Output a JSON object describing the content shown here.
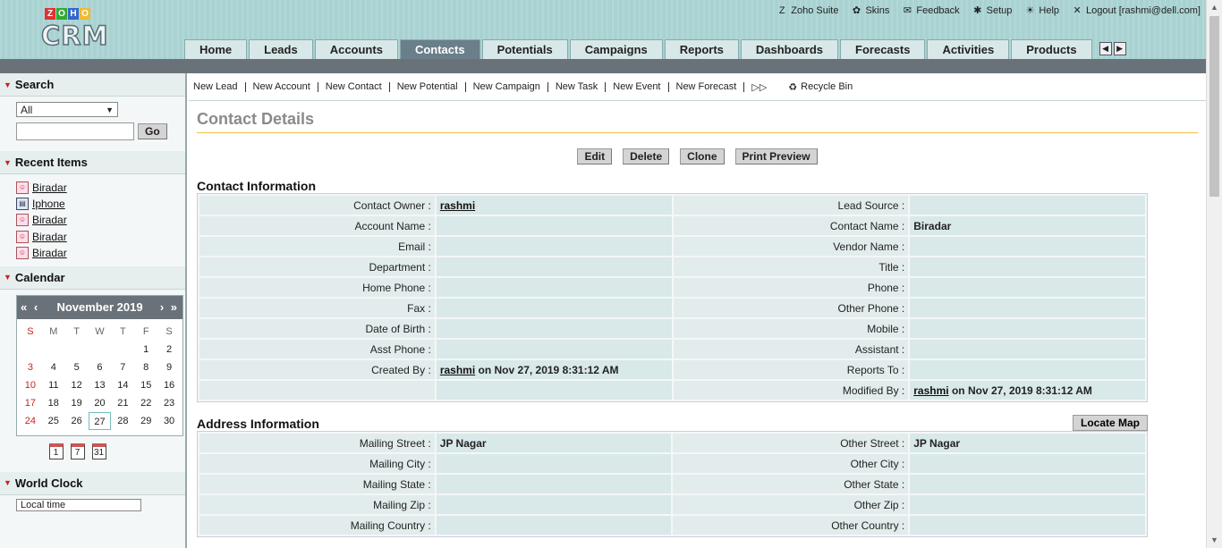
{
  "app": {
    "logo_top": "ZOHO",
    "logo_bottom": "CRM"
  },
  "toplinks": [
    {
      "label": "Zoho Suite",
      "icon": "Z"
    },
    {
      "label": "Skins",
      "icon": "✿"
    },
    {
      "label": "Feedback",
      "icon": "✉"
    },
    {
      "label": "Setup",
      "icon": "✱"
    },
    {
      "label": "Help",
      "icon": "☀"
    },
    {
      "label": "Logout [rashmi@dell.com]",
      "icon": "✕"
    }
  ],
  "tabs": [
    "Home",
    "Leads",
    "Accounts",
    "Contacts",
    "Potentials",
    "Campaigns",
    "Reports",
    "Dashboards",
    "Forecasts",
    "Activities",
    "Products"
  ],
  "active_tab": "Contacts",
  "sidebar": {
    "search": {
      "title": "Search",
      "select_value": "All",
      "go_label": "Go"
    },
    "recent": {
      "title": "Recent Items",
      "items": [
        {
          "label": "Biradar",
          "type": "contact"
        },
        {
          "label": "Iphone",
          "type": "product"
        },
        {
          "label": "Biradar",
          "type": "contact"
        },
        {
          "label": "Biradar",
          "type": "contact"
        },
        {
          "label": "Biradar",
          "type": "contact"
        }
      ]
    },
    "calendar": {
      "title": "Calendar",
      "month": "November 2019",
      "prev": "« ‹",
      "next": "› »",
      "dow": [
        "S",
        "M",
        "T",
        "W",
        "T",
        "F",
        "S"
      ],
      "weeks": [
        [
          "",
          "",
          "",
          "",
          "",
          "1",
          "2"
        ],
        [
          "3",
          "4",
          "5",
          "6",
          "7",
          "8",
          "9"
        ],
        [
          "10",
          "11",
          "12",
          "13",
          "14",
          "15",
          "16"
        ],
        [
          "17",
          "18",
          "19",
          "20",
          "21",
          "22",
          "23"
        ],
        [
          "24",
          "25",
          "26",
          "27",
          "28",
          "29",
          "30"
        ]
      ],
      "today": "27",
      "views": [
        "1",
        "7",
        "31"
      ]
    },
    "worldclock": {
      "title": "World Clock",
      "select_value": "Local time"
    }
  },
  "quicklinks": [
    "New Lead",
    "New Account",
    "New Contact",
    "New Potential",
    "New Campaign",
    "New Task",
    "New Event",
    "New Forecast"
  ],
  "recycle_bin": "Recycle Bin",
  "page_title": "Contact Details",
  "actions": [
    "Edit",
    "Delete",
    "Clone",
    "Print Preview"
  ],
  "contact_info": {
    "title": "Contact Information",
    "rows": [
      {
        "l1": "Contact Owner :",
        "v1": "rashmi",
        "v1_link": true,
        "l2": "Lead Source :",
        "v2": ""
      },
      {
        "l1": "Account Name :",
        "v1": "",
        "l2": "Contact Name :",
        "v2": "Biradar"
      },
      {
        "l1": "Email :",
        "v1": "",
        "l2": "Vendor Name :",
        "v2": ""
      },
      {
        "l1": "Department :",
        "v1": "",
        "l2": "Title :",
        "v2": ""
      },
      {
        "l1": "Home Phone :",
        "v1": "",
        "l2": "Phone :",
        "v2": ""
      },
      {
        "l1": "Fax :",
        "v1": "",
        "l2": "Other Phone :",
        "v2": ""
      },
      {
        "l1": "Date of Birth :",
        "v1": "",
        "l2": "Mobile :",
        "v2": ""
      },
      {
        "l1": "Asst Phone :",
        "v1": "",
        "l2": "Assistant :",
        "v2": ""
      },
      {
        "l1": "Created By :",
        "v1": "rashmi",
        "v1_link": true,
        "v1_suffix": " on Nov 27, 2019 8:31:12 AM",
        "l2": "Reports To :",
        "v2": ""
      },
      {
        "l1": "",
        "v1": "",
        "l2": "Modified By :",
        "v2": "rashmi",
        "v2_link": true,
        "v2_suffix": " on Nov 27, 2019 8:31:12 AM"
      }
    ]
  },
  "address_info": {
    "title": "Address Information",
    "locate_map": "Locate Map",
    "rows": [
      {
        "l1": "Mailing Street :",
        "v1": "JP Nagar",
        "l2": "Other Street :",
        "v2": "JP Nagar"
      },
      {
        "l1": "Mailing City :",
        "v1": "",
        "l2": "Other City :",
        "v2": ""
      },
      {
        "l1": "Mailing State :",
        "v1": "",
        "l2": "Other State :",
        "v2": ""
      },
      {
        "l1": "Mailing Zip :",
        "v1": "",
        "l2": "Other Zip :",
        "v2": ""
      },
      {
        "l1": "Mailing Country :",
        "v1": "",
        "l2": "Other Country :",
        "v2": ""
      }
    ]
  },
  "colors": {
    "header_bg": "#a9d2d2",
    "active_tab": "#6a7f8a",
    "accent_caret": "#cc2222",
    "title_rule": "#f0c040"
  }
}
